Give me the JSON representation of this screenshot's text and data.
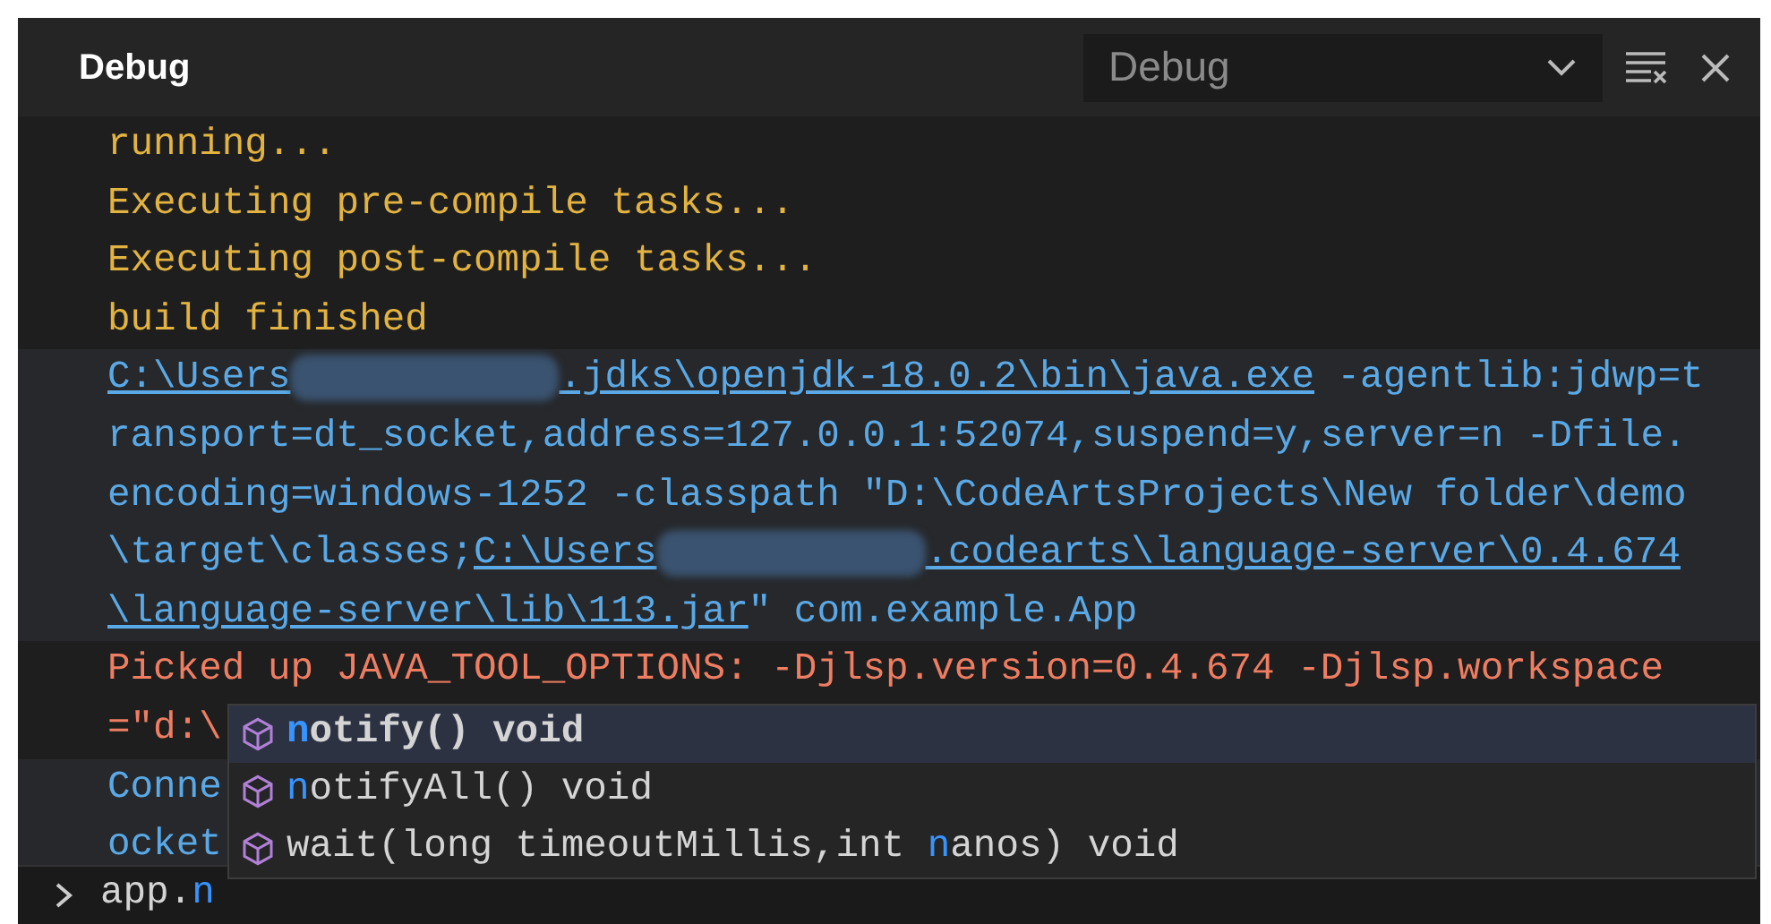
{
  "header": {
    "title": "Debug",
    "dropdown": {
      "value": "Debug"
    }
  },
  "output": [
    {
      "kind": "info",
      "lines": [
        [
          {
            "kind": "text",
            "text": "running..."
          }
        ],
        [
          {
            "kind": "text",
            "text": "Executing pre-compile tasks..."
          }
        ],
        [
          {
            "kind": "text",
            "text": "Executing post-compile tasks..."
          }
        ],
        [
          {
            "kind": "text",
            "text": "build finished"
          }
        ]
      ]
    },
    {
      "kind": "command",
      "lines": [
        [
          {
            "kind": "link",
            "text": "C:\\Users"
          },
          {
            "kind": "redacted"
          },
          {
            "kind": "link",
            "text": ".jdks\\openjdk-18.0.2\\bin\\java.exe"
          },
          {
            "kind": "text",
            "text": " -agentlib:jdwp=t"
          }
        ],
        [
          {
            "kind": "text",
            "text": "ransport=dt_socket,address=127.0.0.1:52074,suspend=y,server=n -Dfile."
          }
        ],
        [
          {
            "kind": "text",
            "text": "encoding=windows-1252 -classpath \"D:\\CodeArtsProjects\\New folder\\demo"
          }
        ],
        [
          {
            "kind": "text",
            "text": "\\target\\classes;"
          },
          {
            "kind": "link",
            "text": "C:\\Users"
          },
          {
            "kind": "redacted"
          },
          {
            "kind": "link",
            "text": ".codearts\\language-server\\0.4.674"
          }
        ],
        [
          {
            "kind": "link",
            "text": "\\language-server\\lib\\113.jar"
          },
          {
            "kind": "text",
            "text": "\" com.example.App"
          }
        ]
      ]
    },
    {
      "kind": "error",
      "lines": [
        [
          {
            "kind": "text",
            "text": "Picked up JAVA_TOOL_OPTIONS: -Djlsp.version=0.4.674 -Djlsp.workspace"
          }
        ],
        [
          {
            "kind": "text",
            "text": "=\"d:\\"
          }
        ]
      ]
    },
    {
      "kind": "command",
      "lines": [
        [
          {
            "kind": "text",
            "text": "Conne"
          }
        ],
        [
          {
            "kind": "text",
            "text": "ocket"
          }
        ]
      ]
    }
  ],
  "suggestions": [
    {
      "selected": true,
      "parts": [
        {
          "text": "n",
          "match": true
        },
        {
          "text": "otify() void",
          "match": false
        }
      ]
    },
    {
      "selected": false,
      "parts": [
        {
          "text": "n",
          "match": true
        },
        {
          "text": "otifyAll() void",
          "match": false
        }
      ]
    },
    {
      "selected": false,
      "parts": [
        {
          "text": "wait(long timeoutMillis,int ",
          "match": false
        },
        {
          "text": "n",
          "match": true
        },
        {
          "text": "anos) void",
          "match": false
        }
      ]
    }
  ],
  "input": {
    "parts": [
      {
        "text": "app.",
        "match": false
      },
      {
        "text": "n",
        "match": true
      }
    ]
  }
}
